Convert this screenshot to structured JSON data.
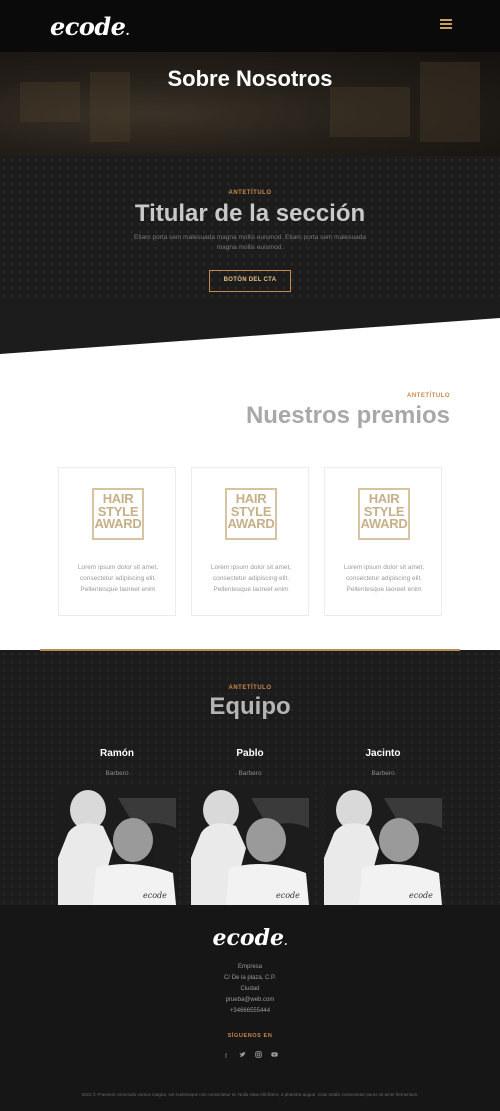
{
  "header": {
    "logo": "ecode",
    "menu_icon": "hamburger-icon"
  },
  "hero": {
    "title": "Sobre Nosotros"
  },
  "section": {
    "pretitle": "ANTETÍTULO",
    "title": "Titular de la sección",
    "text": "Etiam porta sem malesuada magna mollis euismod. Etiam porta sem malesuada magna mollis euismod.",
    "cta": "BOTÓN DEL CTA"
  },
  "premios": {
    "pretitle": "ANTETÍTULO",
    "title": "Nuestros premios",
    "cards": [
      {
        "award_lines": [
          "HAIR",
          "STYLE",
          "AWARD"
        ],
        "text": "Lorem ipsum dolor sit amet, consectetur adipiscing elit. Pellentesque laoreet enim"
      },
      {
        "award_lines": [
          "HAIR",
          "STYLE",
          "AWARD"
        ],
        "text": "Lorem ipsum dolor sit amet, consectetur adipiscing elit. Pellentesque laoreet enim"
      },
      {
        "award_lines": [
          "HAIR",
          "STYLE",
          "AWARD"
        ],
        "text": "Lorem ipsum dolor sit amet, consectetur adipiscing elit. Pellentesque laoreet enim"
      }
    ]
  },
  "equipo": {
    "pretitle": "ANTETÍTULO",
    "title": "Equipo",
    "members": [
      {
        "name": "Ramón",
        "role": "Barbero"
      },
      {
        "name": "Pablo",
        "role": "Barbero"
      },
      {
        "name": "Jacinto",
        "role": "Barbero"
      }
    ]
  },
  "footer": {
    "logo": "ecode",
    "company": "Empresa",
    "address": "C/ De la plaza, C.P.",
    "city": "Ciudad",
    "email": "prueba@web.com",
    "phone": "+34666555444",
    "follow": "SÍGUENOS EN",
    "social_icons": [
      "facebook-icon",
      "twitter-icon",
      "instagram-icon",
      "youtube-icon"
    ],
    "copyright": "2021 © Praesent commodo cursus magna, vel scelerisque nisl consectetur et. Nulla vitae elit libero, a pharetra augue. Cras mattis consectetur purus sit amet fermentum."
  },
  "colors": {
    "accent": "#c9894a",
    "dark_bg": "#1c1c1c",
    "award": "#d6c3a0"
  }
}
